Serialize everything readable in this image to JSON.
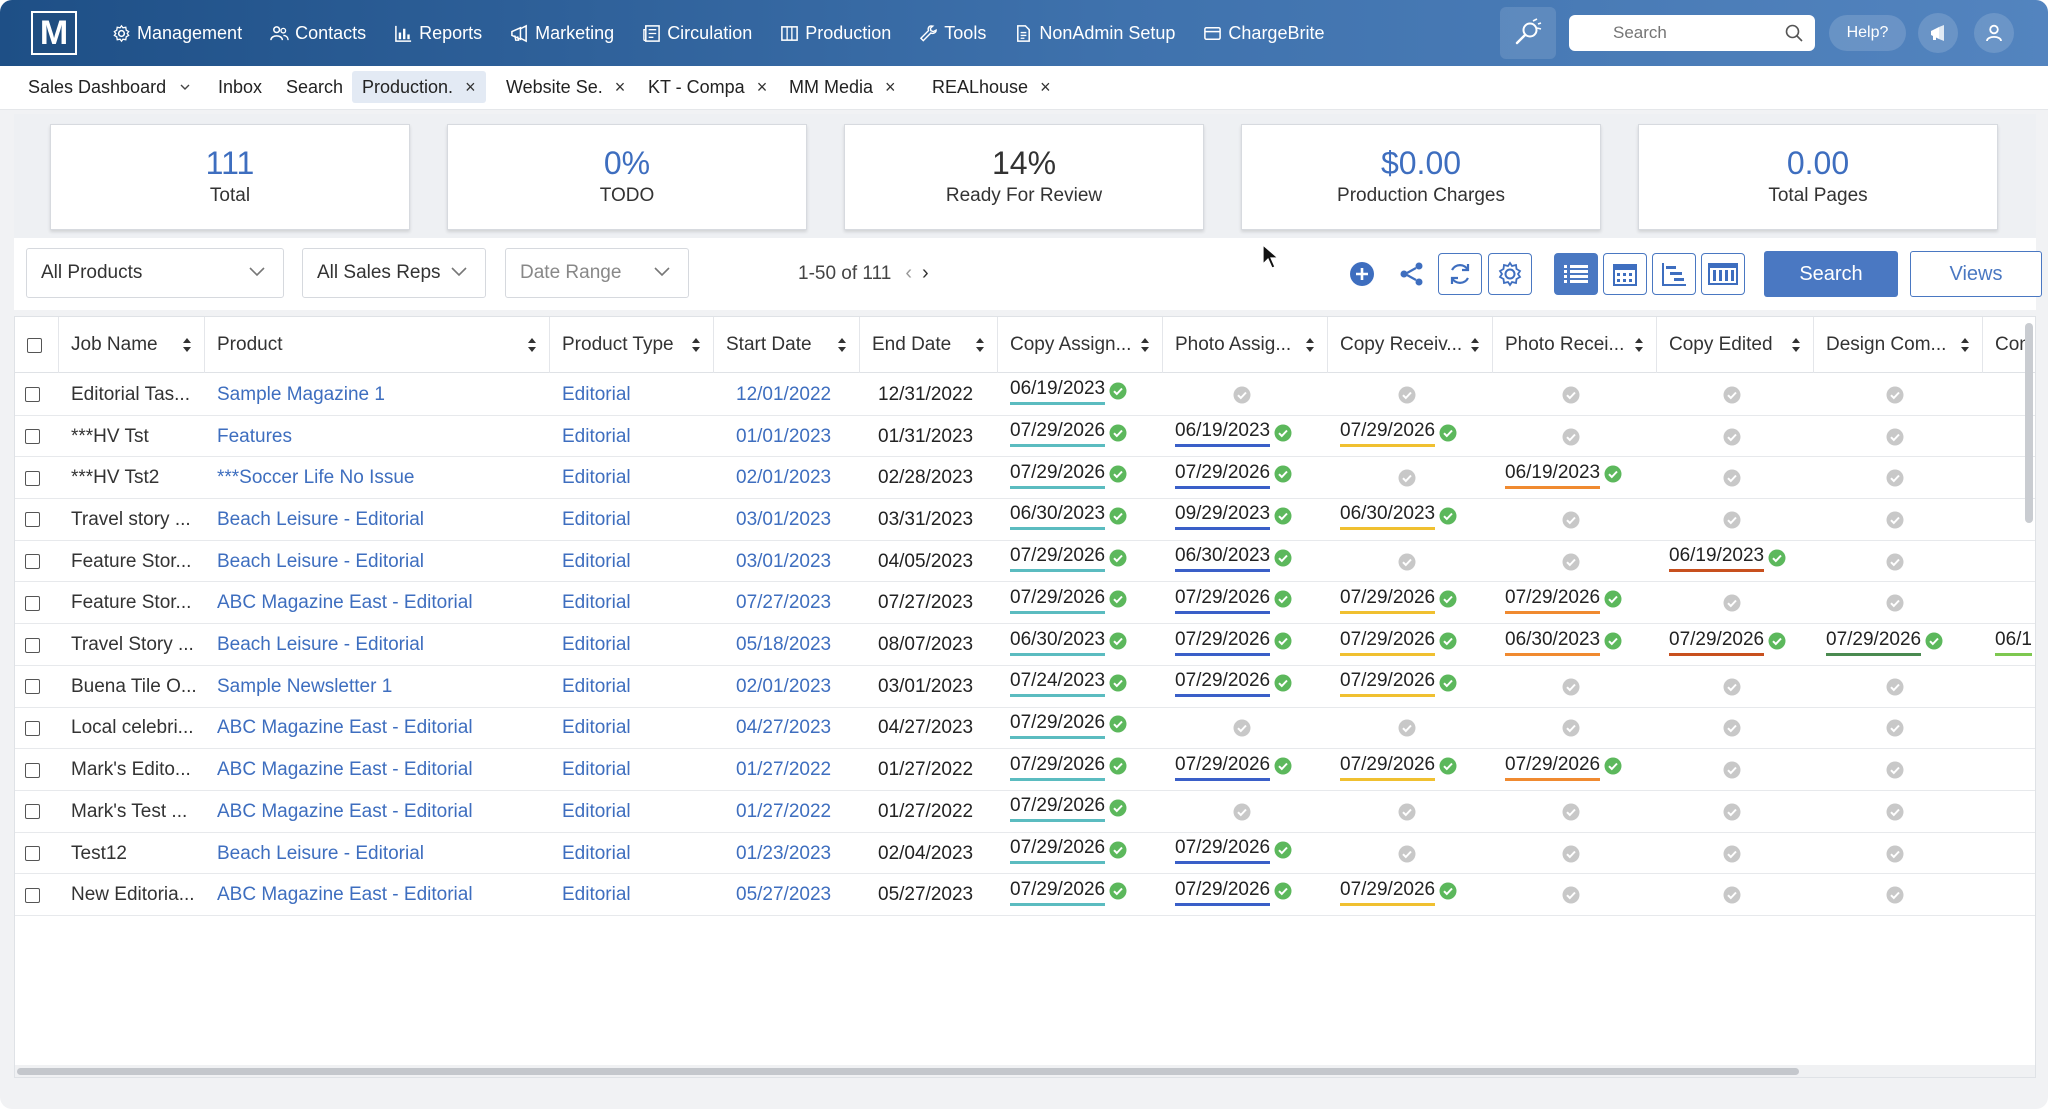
{
  "nav": {
    "logo": "M",
    "items": [
      {
        "label": "Management",
        "icon": "gear-icon"
      },
      {
        "label": "Contacts",
        "icon": "contacts-icon"
      },
      {
        "label": "Reports",
        "icon": "bar-chart-icon"
      },
      {
        "label": "Marketing",
        "icon": "megaphone-icon"
      },
      {
        "label": "Circulation",
        "icon": "newspaper-icon"
      },
      {
        "label": "Production",
        "icon": "columns-icon"
      },
      {
        "label": "Tools",
        "icon": "wrench-icon"
      },
      {
        "label": "NonAdmin Setup",
        "icon": "document-icon"
      },
      {
        "label": "ChargeBrite",
        "icon": "card-icon"
      }
    ],
    "search_placeholder": "Search",
    "help_label": "Help?"
  },
  "tabs": [
    {
      "label": "Sales Dashboard",
      "closable": false,
      "dropdown": true
    },
    {
      "label": "Inbox",
      "closable": false
    },
    {
      "label": "Search",
      "closable": false
    },
    {
      "label": "Production.",
      "closable": true,
      "active": true
    },
    {
      "label": "Website Se.",
      "closable": true
    },
    {
      "label": "KT - Compa",
      "closable": true
    },
    {
      "label": "MM Media",
      "closable": true
    },
    {
      "label": "REALhouse",
      "closable": true
    }
  ],
  "stats": [
    {
      "value": "111",
      "label": "Total"
    },
    {
      "value": "0%",
      "label": "TODO"
    },
    {
      "value": "14%",
      "label": "Ready For Review",
      "dark": true
    },
    {
      "value": "$0.00",
      "label": "Production Charges"
    },
    {
      "value": "0.00",
      "label": "Total Pages"
    }
  ],
  "filters": {
    "products": "All Products",
    "sales_reps": "All Sales Reps",
    "date_range": "Date Range",
    "pager": "1-50 of 111"
  },
  "toolbar": {
    "search_label": "Search",
    "views_label": "Views"
  },
  "colors": {
    "copy_assigned": "#5bbcc0",
    "photo_assigned": "#3a5fc8",
    "copy_received": "#f0c030",
    "photo_received": "#f08a30",
    "copy_edited": "#c8501e",
    "design_complete": "#4a8a50",
    "con": "#7ec850",
    "check_green": "#5cb85c",
    "check_grey": "#c8c8c8"
  },
  "columns": [
    "Job Name",
    "Product",
    "Product Type",
    "Start Date",
    "End Date",
    "Copy Assign...",
    "Photo Assig...",
    "Copy Receiv...",
    "Photo Recei...",
    "Copy Edited",
    "Design Com...",
    "Con"
  ],
  "rows": [
    {
      "job": "Editorial Tas...",
      "product": "Sample Magazine 1",
      "type": "Editorial",
      "start": "12/01/2022",
      "end": "12/31/2022",
      "stages": [
        "06/19/2023",
        "",
        "",
        "",
        "",
        "",
        null
      ]
    },
    {
      "job": "***HV Tst",
      "product": "Features",
      "type": "Editorial",
      "start": "01/01/2023",
      "end": "01/31/2023",
      "stages": [
        "07/29/2026",
        "06/19/2023",
        "07/29/2026",
        "",
        "",
        "",
        null
      ]
    },
    {
      "job": "***HV Tst2",
      "product": "***Soccer Life No Issue",
      "type": "Editorial",
      "start": "02/01/2023",
      "end": "02/28/2023",
      "stages": [
        "07/29/2026",
        "07/29/2026",
        "",
        "06/19/2023",
        "",
        "",
        null
      ]
    },
    {
      "job": "Travel story ...",
      "product": "Beach Leisure - Editorial",
      "type": "Editorial",
      "start": "03/01/2023",
      "end": "03/31/2023",
      "stages": [
        "06/30/2023",
        "09/29/2023",
        "06/30/2023",
        "",
        "",
        "",
        null
      ]
    },
    {
      "job": "Feature Stor...",
      "product": "Beach Leisure - Editorial",
      "type": "Editorial",
      "start": "03/01/2023",
      "end": "04/05/2023",
      "stages": [
        "07/29/2026",
        "06/30/2023",
        "",
        "",
        "06/19/2023",
        "",
        null
      ]
    },
    {
      "job": "Feature Stor...",
      "product": "ABC Magazine East - Editorial",
      "type": "Editorial",
      "start": "07/27/2023",
      "end": "07/27/2023",
      "stages": [
        "07/29/2026",
        "07/29/2026",
        "07/29/2026",
        "07/29/2026",
        "",
        "",
        null
      ]
    },
    {
      "job": "Travel Story ...",
      "product": "Beach Leisure - Editorial",
      "type": "Editorial",
      "start": "05/18/2023",
      "end": "08/07/2023",
      "stages": [
        "06/30/2023",
        "07/29/2026",
        "07/29/2026",
        "06/30/2023",
        "07/29/2026",
        "07/29/2026",
        "06/1"
      ]
    },
    {
      "job": "Buena Tile O...",
      "product": "Sample Newsletter 1",
      "type": "Editorial",
      "start": "02/01/2023",
      "end": "03/01/2023",
      "stages": [
        "07/24/2023",
        "07/29/2026",
        "07/29/2026",
        "",
        "",
        "",
        null
      ]
    },
    {
      "job": "Local celebri...",
      "product": "ABC Magazine East - Editorial",
      "type": "Editorial",
      "start": "04/27/2023",
      "end": "04/27/2023",
      "stages": [
        "07/29/2026",
        "",
        "",
        "",
        "",
        "",
        null
      ]
    },
    {
      "job": "Mark's Edito...",
      "product": "ABC Magazine East - Editorial",
      "type": "Editorial",
      "start": "01/27/2022",
      "end": "01/27/2022",
      "stages": [
        "07/29/2026",
        "07/29/2026",
        "07/29/2026",
        "07/29/2026",
        "",
        "",
        null
      ]
    },
    {
      "job": "Mark's Test ...",
      "product": "ABC Magazine East - Editorial",
      "type": "Editorial",
      "start": "01/27/2022",
      "end": "01/27/2022",
      "stages": [
        "07/29/2026",
        "",
        "",
        "",
        "",
        "",
        null
      ]
    },
    {
      "job": "Test12",
      "product": "Beach Leisure - Editorial",
      "type": "Editorial",
      "start": "01/23/2023",
      "end": "02/04/2023",
      "stages": [
        "07/29/2026",
        "07/29/2026",
        "",
        "",
        "",
        "",
        null
      ]
    },
    {
      "job": "New Editoria...",
      "product": "ABC Magazine East - Editorial",
      "type": "Editorial",
      "start": "05/27/2023",
      "end": "05/27/2023",
      "stages": [
        "07/29/2026",
        "07/29/2026",
        "07/29/2026",
        "",
        "",
        "",
        null
      ]
    }
  ]
}
